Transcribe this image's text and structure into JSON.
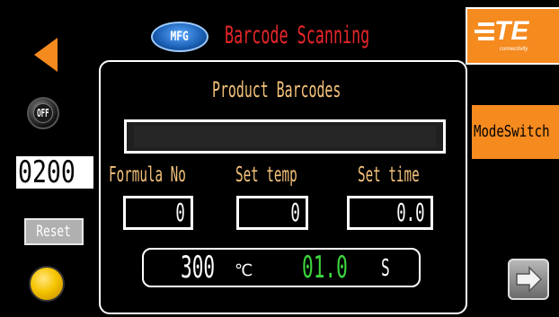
{
  "header": {
    "badge": "MFG",
    "title": "Barcode Scanning"
  },
  "left_panel": {
    "off_label": "OFF",
    "counter": "0200",
    "reset_label": "Reset"
  },
  "right_panel": {
    "logo_text": "TE",
    "logo_tagline": "connectivity",
    "mode_switch_label": "ModeSwitch"
  },
  "main": {
    "title": "Product Barcodes",
    "barcode_value": "",
    "fields": {
      "formula": {
        "label": "Formula No",
        "value": "0"
      },
      "temp": {
        "label": "Set temp",
        "value": "0"
      },
      "time": {
        "label": "Set time",
        "value": "0.0"
      }
    },
    "status": {
      "temperature": "300",
      "temperature_unit": "℃",
      "time": "01.0",
      "time_unit": "S"
    }
  },
  "colors": {
    "title_red": "#e8262a",
    "label_gold": "#f4c27a",
    "brand_orange": "#f58a1f",
    "timer_green": "#3dd63d",
    "lamp_yellow": "#f5c400"
  },
  "icons": [
    "back-arrow-icon",
    "off-button-icon",
    "indicator-lamp-icon",
    "mfg-badge-icon",
    "te-logo-icon",
    "next-icon"
  ]
}
